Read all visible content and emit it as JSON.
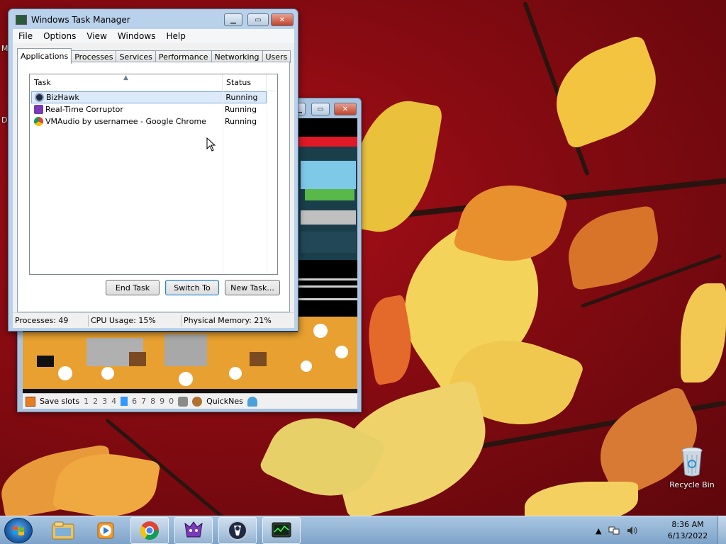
{
  "desktop": {
    "cut_labels": [
      "M",
      "D"
    ],
    "recycle_bin_label": "Recycle Bin"
  },
  "bizhawk": {
    "status_bar": {
      "save_slots_label": "Save slots",
      "slots": [
        "1",
        "2",
        "3",
        "4",
        "5",
        "6",
        "7",
        "8",
        "9",
        "0"
      ],
      "active_slot": "5",
      "core_label": "QuickNes"
    }
  },
  "task_manager": {
    "title": "Windows Task Manager",
    "menu": [
      "File",
      "Options",
      "View",
      "Windows",
      "Help"
    ],
    "tabs": [
      "Applications",
      "Processes",
      "Services",
      "Performance",
      "Networking",
      "Users"
    ],
    "active_tab": "Applications",
    "columns": {
      "task": "Task",
      "status": "Status"
    },
    "rows": [
      {
        "task": "BizHawk",
        "status": "Running",
        "icon": "bizhawk-icon",
        "selected": true
      },
      {
        "task": "Real-Time Corruptor",
        "status": "Running",
        "icon": "rtc-icon",
        "selected": false
      },
      {
        "task": "VMAudio by usernamee - Google Chrome",
        "status": "Running",
        "icon": "chrome-icon",
        "selected": false
      }
    ],
    "buttons": {
      "end_task": "End Task",
      "switch_to": "Switch To",
      "new_task": "New Task..."
    },
    "status_bar": {
      "processes": "Processes: 49",
      "cpu": "CPU Usage: 15%",
      "memory": "Physical Memory: 21%"
    }
  },
  "taskbar": {
    "items": [
      "explorer-icon",
      "media-player-icon",
      "chrome-icon",
      "rtc-icon",
      "bizhawk-icon",
      "task-manager-icon"
    ],
    "clock_time": "8:36 AM",
    "clock_date": "6/13/2022"
  },
  "colors": {
    "window_frame": "#b9d1ea",
    "selection": "#dce9f8",
    "taskbar": "#8fb2d6"
  }
}
